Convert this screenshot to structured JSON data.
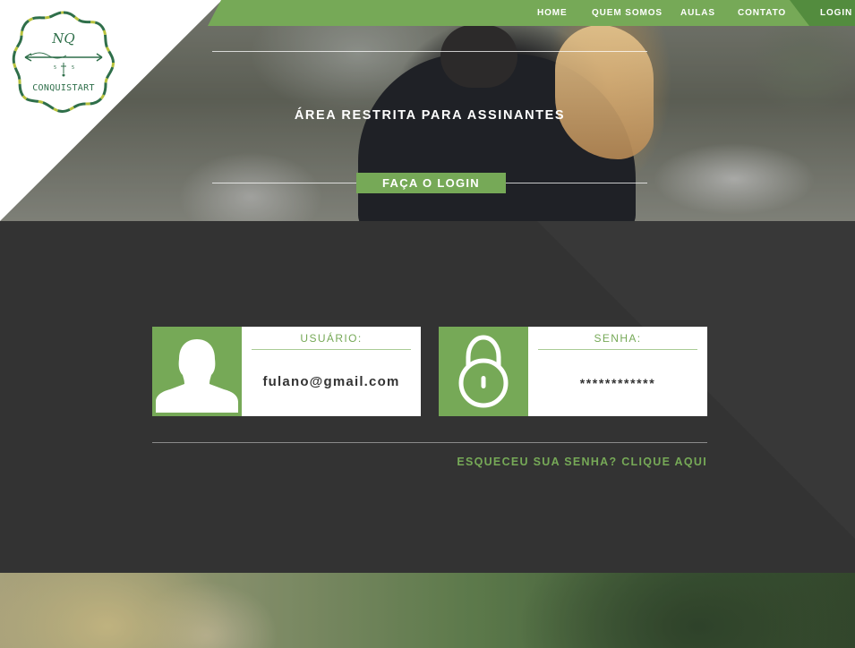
{
  "brand": {
    "logo_monogram": "NQ",
    "logo_name": "CONQUISTART",
    "accent_color": "#76a957",
    "login_dark_color": "#538c3e"
  },
  "nav": {
    "items": [
      {
        "label": "HOME"
      },
      {
        "label": "QUEM SOMOS"
      },
      {
        "label": "AULAS"
      },
      {
        "label": "CONTATO"
      }
    ],
    "login_label": "LOGIN"
  },
  "hero": {
    "title": "ÁREA RESTRITA PARA ASSINANTES",
    "button_label": "FAÇA O LOGIN"
  },
  "login": {
    "user_field": {
      "label": "USUÁRIO:",
      "value": "fulano@gmail.com",
      "icon": "user-icon"
    },
    "password_field": {
      "label": "SENHA:",
      "value": "************",
      "icon": "lock-icon"
    },
    "forgot_link": "ESQUECEU SUA SENHA? CLIQUE AQUI"
  }
}
